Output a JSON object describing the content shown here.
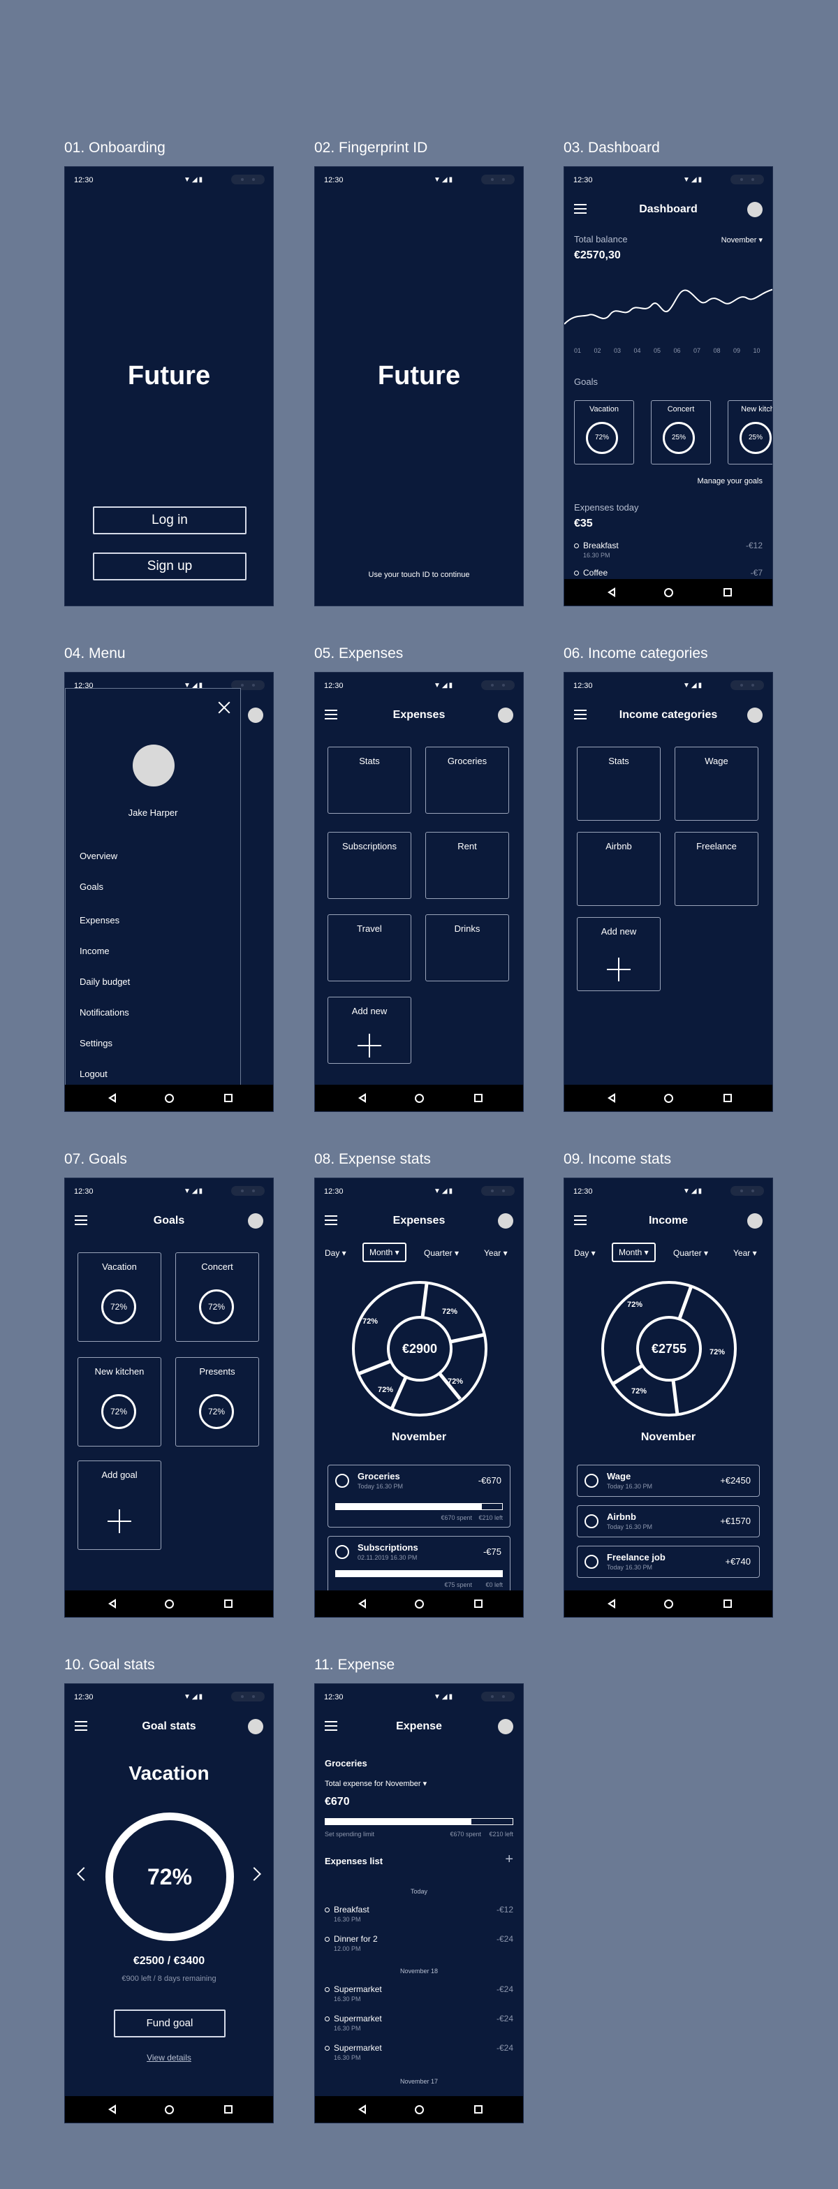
{
  "status": {
    "time": "12:30",
    "icons": "▼◢▮"
  },
  "nav": {
    "back": "back",
    "home": "home",
    "recent": "recent"
  },
  "screens": {
    "s1": {
      "label": "01. Onboarding",
      "logo": "Future",
      "login": "Log in",
      "signup": "Sign up"
    },
    "s2": {
      "label": "02. Fingerprint ID",
      "logo": "Future",
      "hint": "Use your touch ID to continue"
    },
    "s3": {
      "label": "03. Dashboard",
      "title": "Dashboard",
      "balance_label": "Total balance",
      "balance": "€2570,30",
      "month": "November ▾",
      "x_ticks": [
        "01",
        "02",
        "03",
        "04",
        "05",
        "06",
        "07",
        "08",
        "09",
        "10"
      ],
      "goals_label": "Goals",
      "goals": [
        {
          "name": "Vacation",
          "pct": "72%"
        },
        {
          "name": "Concert",
          "pct": "25%"
        },
        {
          "name": "New kitch",
          "pct": "25%"
        }
      ],
      "manage": "Manage your goals",
      "expenses_label": "Expenses today",
      "expenses_total": "€35",
      "items": [
        {
          "name": "Breakfast",
          "time": "16.30 PM",
          "amount": "-€12"
        },
        {
          "name": "Coffee",
          "time": "",
          "amount": "-€7"
        }
      ]
    },
    "s4": {
      "label": "04. Menu",
      "user": "Jake Harper",
      "items": [
        "Overview",
        "Goals",
        "Expenses",
        "Income",
        "Daily budget",
        "Notifications",
        "Settings",
        "Logout"
      ]
    },
    "s5": {
      "label": "05. Expenses",
      "title": "Expenses",
      "tiles": [
        "Stats",
        "Groceries",
        "Subscriptions",
        "Rent",
        "Travel",
        "Drinks"
      ],
      "add": "Add new"
    },
    "s6": {
      "label": "06. Income categories",
      "title": "Income categories",
      "tiles": [
        "Stats",
        "Wage",
        "Airbnb",
        "Freelance"
      ],
      "add": "Add new"
    },
    "s7": {
      "label": "07. Goals",
      "title": "Goals",
      "goals": [
        {
          "name": "Vacation",
          "pct": "72%"
        },
        {
          "name": "Concert",
          "pct": "72%"
        },
        {
          "name": "New kitchen",
          "pct": "72%"
        },
        {
          "name": "Presents",
          "pct": "72%"
        }
      ],
      "add": "Add goal"
    },
    "s8": {
      "label": "08. Expense stats",
      "title": "Expenses",
      "filters": [
        "Day ▾",
        "Month ▾",
        "Quarter ▾",
        "Year ▾"
      ],
      "center": "€2900",
      "slices": [
        "72%",
        "72%",
        "72%",
        "72%",
        "72%"
      ],
      "month": "November",
      "cards": [
        {
          "name": "Groceries",
          "date": "Today 16.30 PM",
          "amount": "-€670",
          "spent": "€670 spent",
          "left": "€210 left",
          "progress": 0.88
        },
        {
          "name": "Subscriptions",
          "date": "02.11.2019 16.30 PM",
          "amount": "-€75",
          "spent": "€75 spent",
          "left": "€0 left",
          "progress": 1.0
        }
      ]
    },
    "s9": {
      "label": "09. Income stats",
      "title": "Income",
      "filters": [
        "Day ▾",
        "Month ▾",
        "Quarter ▾",
        "Year ▾"
      ],
      "center": "€2755",
      "slices": [
        "72%",
        "72%",
        "72%"
      ],
      "month": "November",
      "cards": [
        {
          "name": "Wage",
          "date": "Today 16.30 PM",
          "amount": "+€2450"
        },
        {
          "name": "Airbnb",
          "date": "Today 16.30 PM",
          "amount": "+€1570"
        },
        {
          "name": "Freelance job",
          "date": "Today 16.30 PM",
          "amount": "+€740"
        }
      ]
    },
    "s10": {
      "label": "10. Goal stats",
      "title": "Goal stats",
      "goal": "Vacation",
      "pct": "72%",
      "progress": 0.72,
      "amount": "€2500 / €3400",
      "remaining": "€900 left / 8 days remaining",
      "fund": "Fund goal",
      "details": "View details"
    },
    "s11": {
      "label": "11. Expense",
      "title": "Expense",
      "category": "Groceries",
      "total_label": "Total expense for November ▾",
      "total": "€670",
      "limit": "Set spending limit",
      "spent": "€670 spent",
      "left": "€210 left",
      "progress": 0.78,
      "list_label": "Expenses list",
      "add": "+",
      "groups": [
        {
          "date": "Today",
          "items": [
            {
              "name": "Breakfast",
              "time": "16.30 PM",
              "amount": "-€12"
            },
            {
              "name": "Dinner for 2",
              "time": "12.00 PM",
              "amount": "-€24"
            }
          ]
        },
        {
          "date": "November 18",
          "items": [
            {
              "name": "Supermarket",
              "time": "16.30 PM",
              "amount": "-€24"
            },
            {
              "name": "Supermarket",
              "time": "16.30 PM",
              "amount": "-€24"
            },
            {
              "name": "Supermarket",
              "time": "16.30 PM",
              "amount": "-€24"
            }
          ]
        },
        {
          "date": "November 17",
          "items": []
        }
      ]
    }
  }
}
